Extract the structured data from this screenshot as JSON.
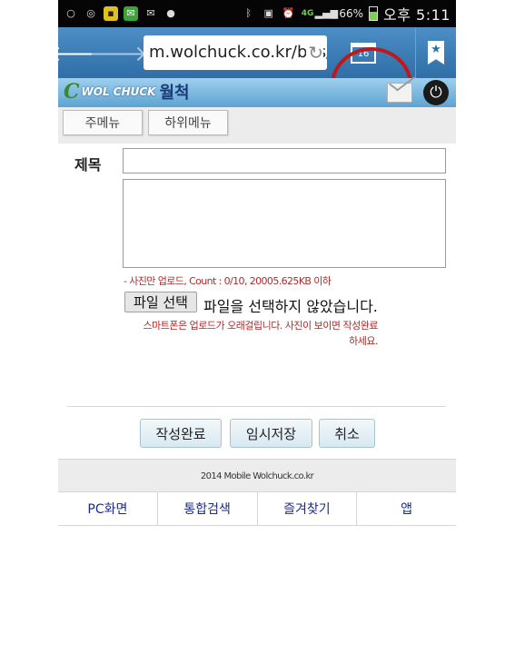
{
  "status_bar": {
    "left_icons": [
      "circle-icon",
      "sync-icon",
      "chat-icon",
      "mail-icon",
      "envelope-icon",
      "talk-icon"
    ],
    "network": "4G",
    "battery": "66%",
    "battery_level": 0.66,
    "time": "오후 5:11"
  },
  "browser": {
    "url": "m.wolchuck.co.kr/bbs/b",
    "tab_count": "16"
  },
  "site": {
    "logo_letter": "C",
    "logo_english": "WOL CHUCK",
    "logo_korean": "월척"
  },
  "menu": {
    "main_menu": "주메뉴",
    "sub_menu": "하위메뉴"
  },
  "form": {
    "title_label": "제목",
    "title_value": "",
    "body_value": "",
    "upload_hint": "- 사진만 업로드, Count : 0/10, 20005.625KB 이하",
    "file_button": "파일 선택",
    "file_status": "파일을 선택하지 않았습니다.",
    "upload_wait_hint": "스마트폰은 업로드가 오래걸립니다. 사진이 보이면 작성완료 하세요."
  },
  "actions": {
    "submit": "작성완료",
    "save_draft": "임시저장",
    "cancel": "취소"
  },
  "footer": {
    "copyright": "2014 Mobile Wolchuck.co.kr"
  },
  "bottom_nav": [
    "PC화면",
    "통합검색",
    "즐겨찾기",
    "앱"
  ],
  "colors": {
    "browser_bar": "#3c7db6",
    "annotation_circle": "#c01818",
    "hint_text": "#b02a2a",
    "nav_link": "#1a2a8a"
  }
}
